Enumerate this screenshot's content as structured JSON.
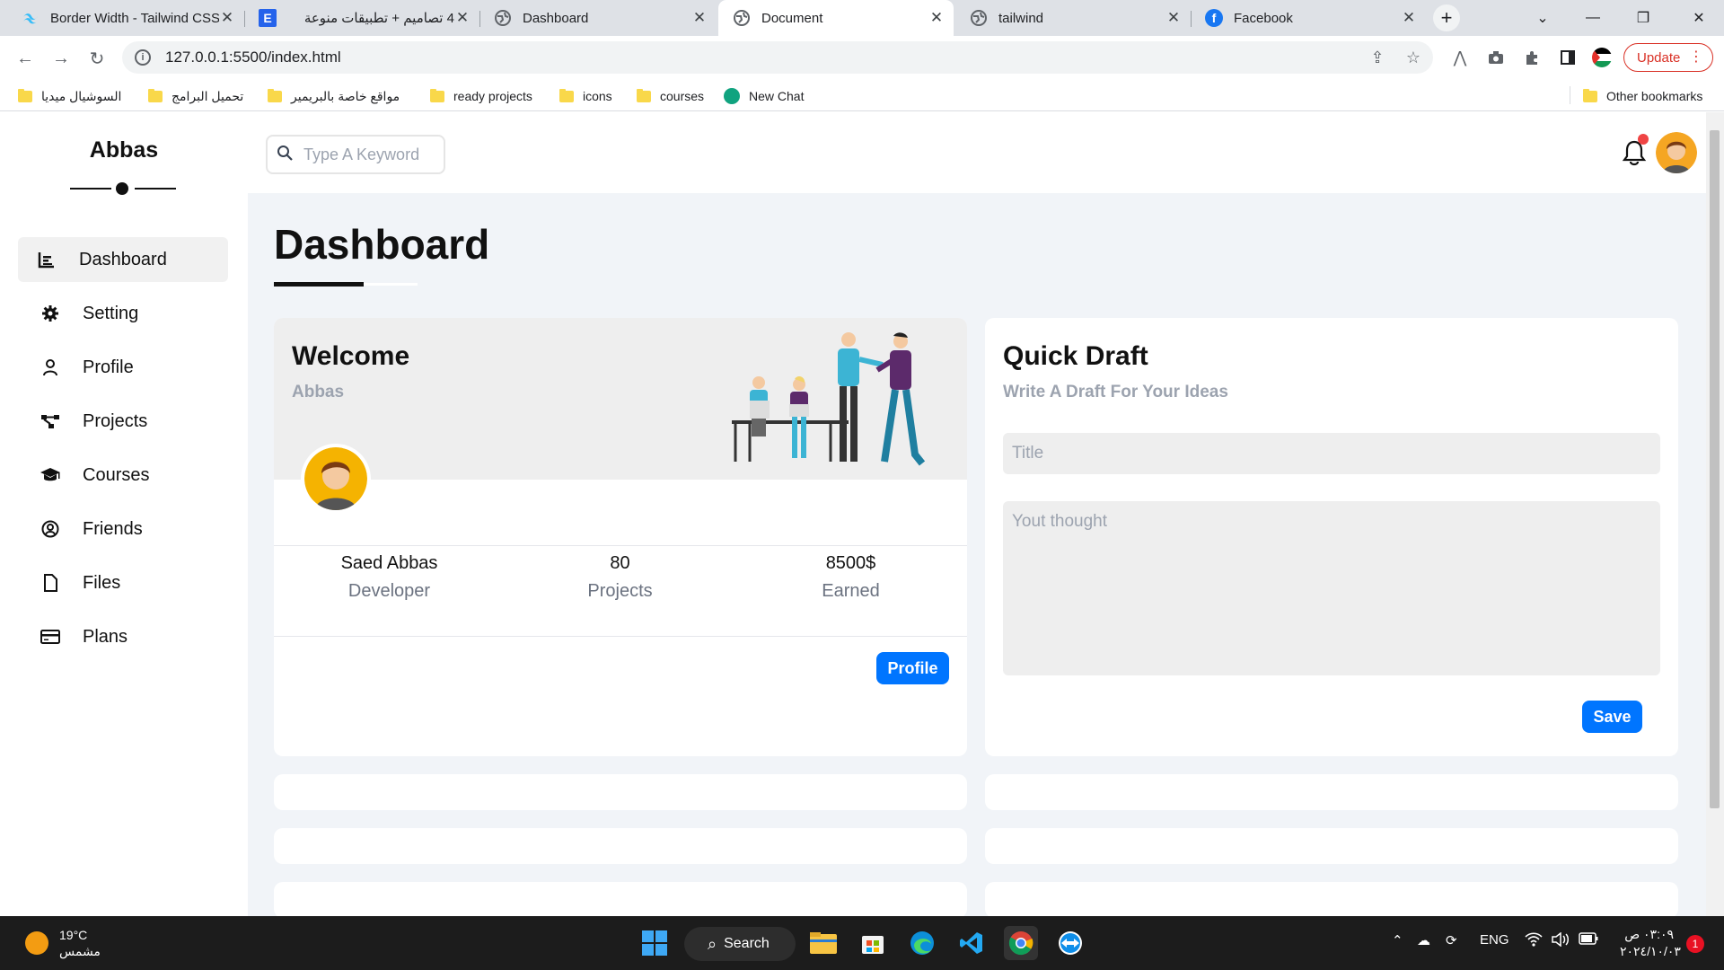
{
  "browser": {
    "tabs": [
      {
        "title": "Border Width - Tailwind CSS",
        "icon": "tailwind-icon"
      },
      {
        "title": "4 تصاميم + تطبيقات منوعة",
        "icon": "e-icon"
      },
      {
        "title": "Dashboard",
        "icon": "globe-icon"
      },
      {
        "title": "Document",
        "icon": "globe-icon",
        "active": true
      },
      {
        "title": "tailwind",
        "icon": "globe-icon"
      },
      {
        "title": "Facebook",
        "icon": "facebook-icon"
      }
    ],
    "url": "127.0.0.1:5500/index.html",
    "update_label": "Update",
    "bookmarks": [
      "السوشيال ميديا",
      "تحميل البرامج",
      "مواقع خاصة بالبريمير",
      "ready projects",
      "icons",
      "courses",
      "New Chat"
    ],
    "other_bookmarks": "Other bookmarks"
  },
  "sidebar": {
    "brand": "Abbas",
    "items": [
      {
        "label": "Dashboard",
        "icon": "chart-icon",
        "active": true
      },
      {
        "label": "Setting",
        "icon": "gear-icon"
      },
      {
        "label": "Profile",
        "icon": "user-icon"
      },
      {
        "label": "Projects",
        "icon": "diagram-icon"
      },
      {
        "label": "Courses",
        "icon": "graduation-cap-icon"
      },
      {
        "label": "Friends",
        "icon": "user-circle-icon"
      },
      {
        "label": "Files",
        "icon": "file-icon"
      },
      {
        "label": "Plans",
        "icon": "credit-card-icon"
      }
    ]
  },
  "topbar": {
    "search_placeholder": "Type A Keyword"
  },
  "main": {
    "title": "Dashboard",
    "welcome": {
      "title": "Welcome",
      "name": "Abbas",
      "stats": [
        {
          "value": "Saed Abbas",
          "label": "Developer"
        },
        {
          "value": "80",
          "label": "Projects"
        },
        {
          "value": "8500$",
          "label": "Earned"
        }
      ],
      "button": "Profile"
    },
    "draft": {
      "title": "Quick Draft",
      "subtitle": "Write A Draft For Your Ideas",
      "title_placeholder": "Title",
      "body_placeholder": "Yout thought",
      "button": "Save"
    }
  },
  "taskbar": {
    "temperature": "19°C",
    "weather": "مشمس",
    "search": "Search",
    "lang": "ENG",
    "time": "٠٣:٠٩ ص",
    "date": "٢٠٢٤/١٠/٠٣",
    "notifications": "1"
  },
  "colors": {
    "accent": "#0075ff",
    "page_bg": "#f1f4f8",
    "bell_badge": "#ef4444"
  }
}
